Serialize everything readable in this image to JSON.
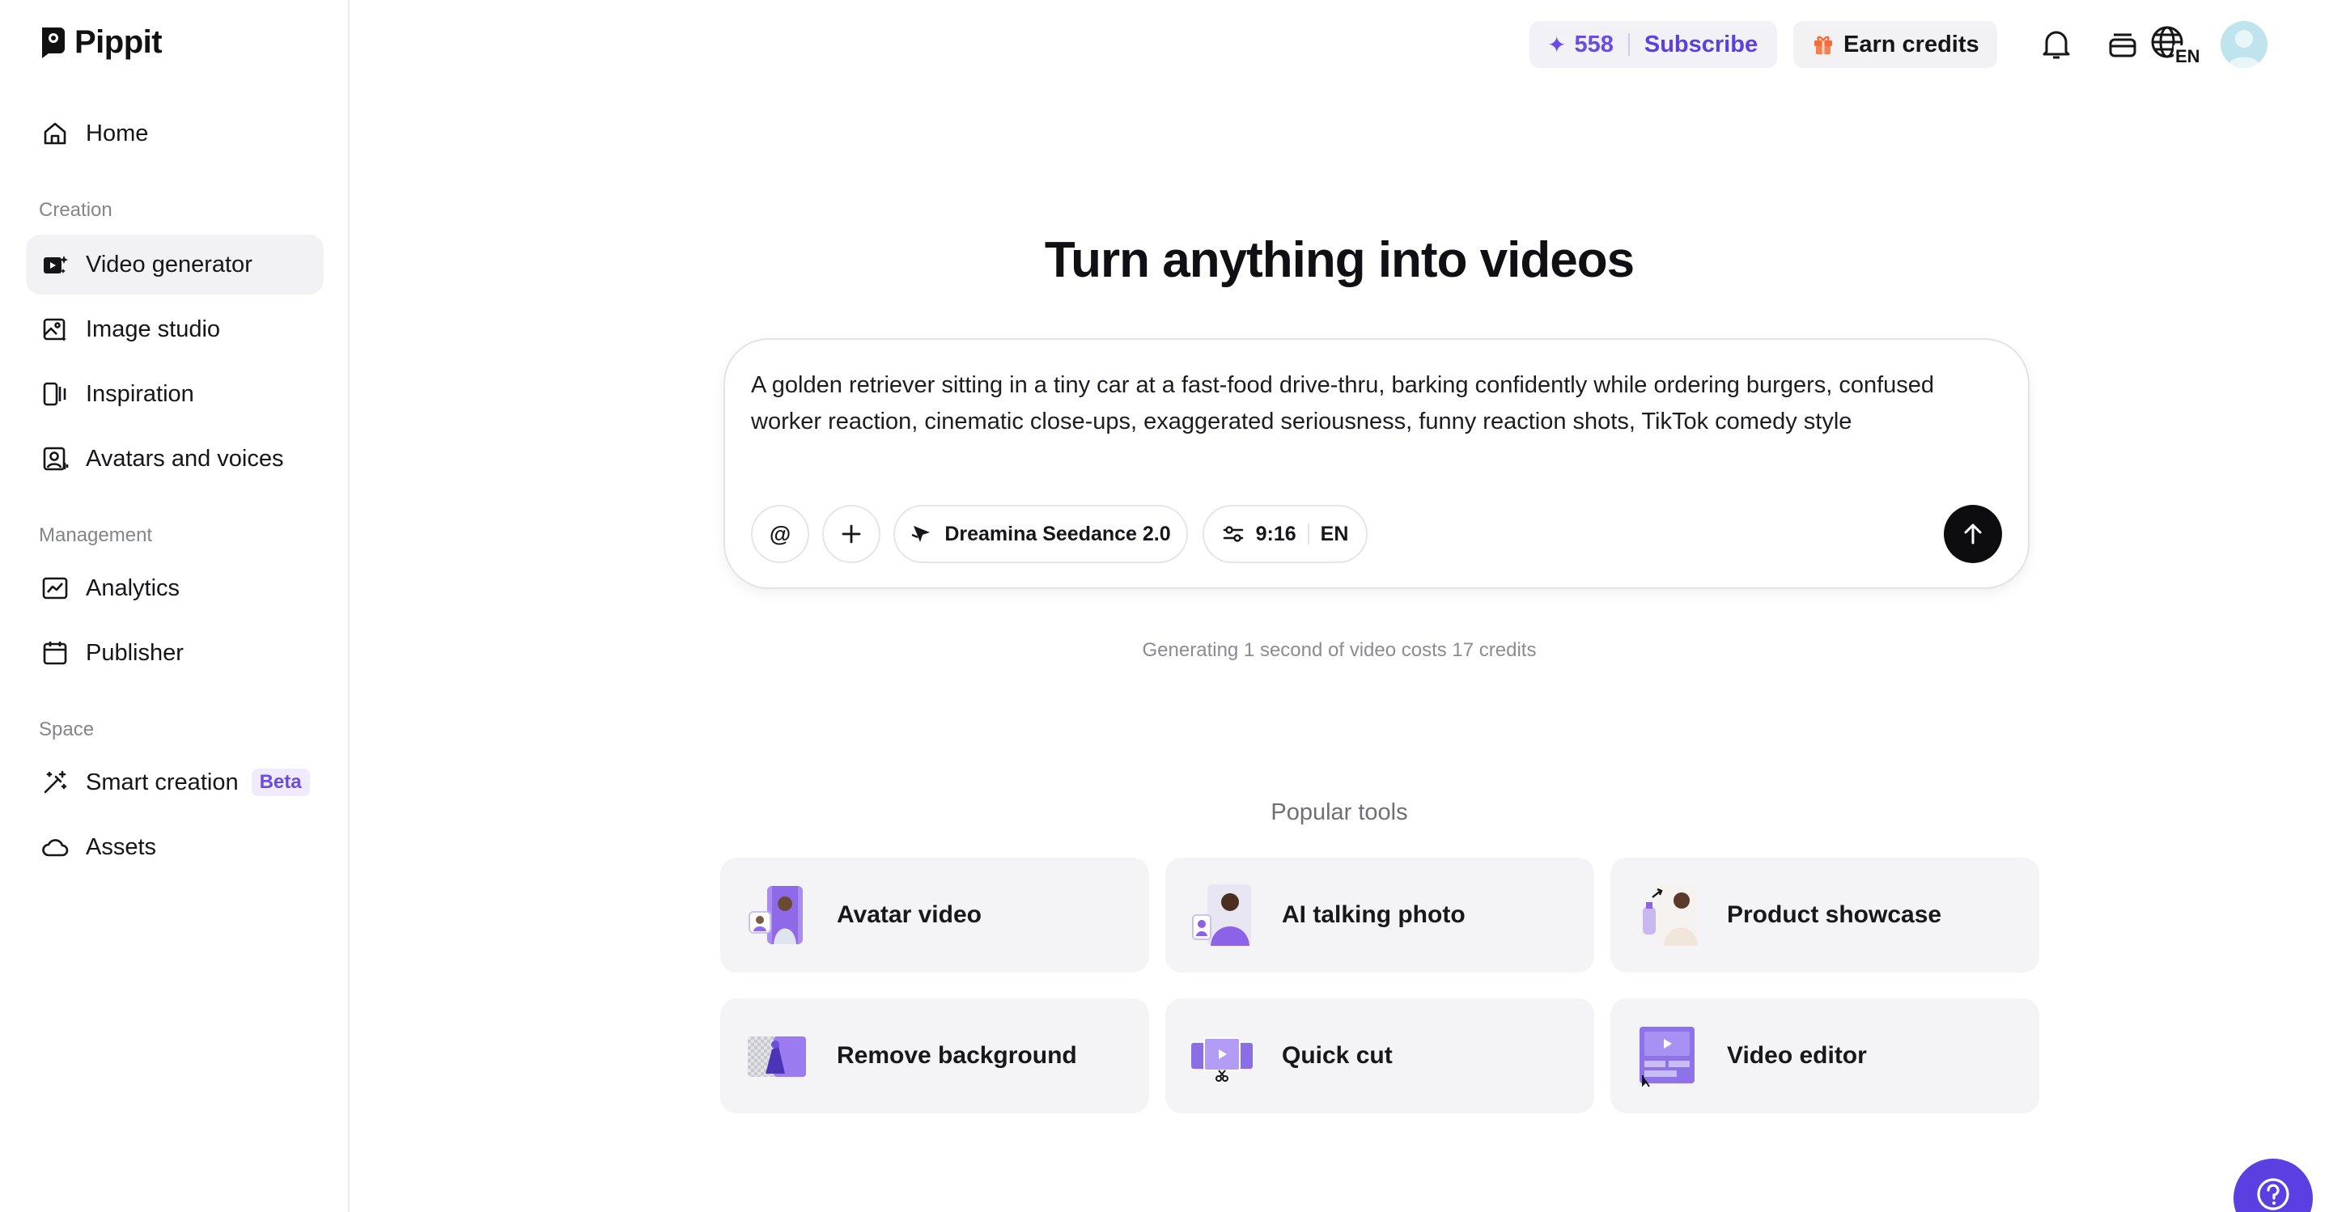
{
  "app": {
    "name": "Pippit"
  },
  "sidebar": {
    "home_label": "Home",
    "sections": {
      "creation": "Creation",
      "management": "Management",
      "space": "Space"
    },
    "items": {
      "video_generator": "Video generator",
      "image_studio": "Image studio",
      "inspiration": "Inspiration",
      "avatars_voices": "Avatars and voices",
      "analytics": "Analytics",
      "publisher": "Publisher",
      "smart_creation": "Smart creation",
      "smart_creation_badge": "Beta",
      "assets": "Assets"
    },
    "active_item": "Video generator"
  },
  "topbar": {
    "credits": "558",
    "subscribe_label": "Subscribe",
    "earn_label": "Earn credits",
    "language_code": "EN"
  },
  "hero": {
    "title": "Turn anything into videos",
    "prompt_text": "A golden retriever sitting in a tiny car at a fast-food drive-thru, barking confidently while ordering burgers, confused worker reaction, cinematic close-ups, exaggerated seriousness, funny reaction shots, TikTok comedy style",
    "mention_label": "@",
    "model_label": "Dreamina Seedance 2.0",
    "aspect_ratio": "9:16",
    "language": "EN",
    "cost_note": "Generating 1 second of video costs 17 credits"
  },
  "popular_tools": {
    "title": "Popular tools",
    "tools": [
      {
        "label": "Avatar video",
        "icon": "avatar-video-thumbnail"
      },
      {
        "label": "AI talking photo",
        "icon": "talking-photo-thumbnail"
      },
      {
        "label": "Product showcase",
        "icon": "product-showcase-thumbnail"
      },
      {
        "label": "Remove background",
        "icon": "remove-background-thumbnail"
      },
      {
        "label": "Quick cut",
        "icon": "quick-cut-thumbnail"
      },
      {
        "label": "Video editor",
        "icon": "video-editor-thumbnail"
      }
    ]
  },
  "colors": {
    "accent": "#5c3fe0",
    "accent_light": "#efeafc",
    "active_bg": "#f2f2f4",
    "card_bg": "#f4f4f6"
  }
}
